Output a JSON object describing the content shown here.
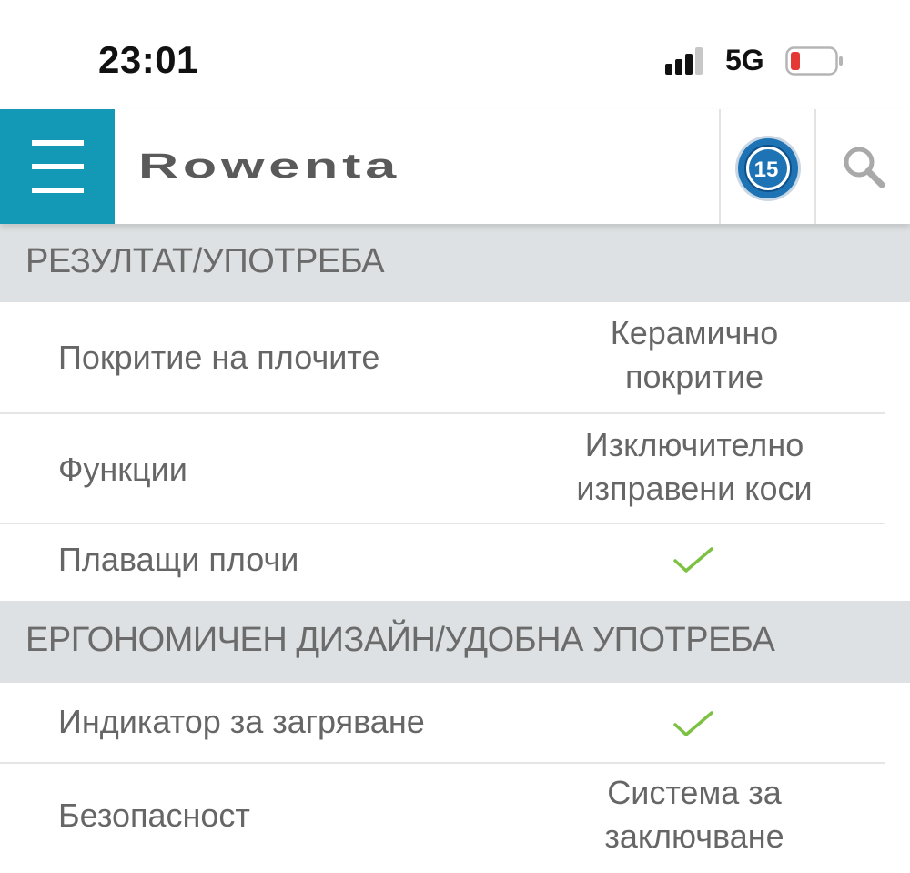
{
  "status_bar": {
    "time": "23:01",
    "network": "5G",
    "icons": [
      "signal-icon",
      "battery-low-icon"
    ]
  },
  "header": {
    "brand": "Rowenta",
    "badge_number": "15",
    "icons": [
      "hamburger-menu-icon",
      "warranty-badge-icon",
      "search-icon"
    ],
    "colors": {
      "menu_background": "#1398b6",
      "badge_blue": "#1e73b4"
    }
  },
  "sections": [
    {
      "title": "РЕЗУЛТАТ/УПОТРЕБА",
      "rows": [
        {
          "label": "Покритие на плочите",
          "value_lines": [
            "Керамично",
            "покритие"
          ]
        },
        {
          "label": "Функции",
          "value_lines": [
            "Изключително",
            "изправени коси"
          ]
        },
        {
          "label": "Плаващи плочи",
          "check": true
        }
      ]
    },
    {
      "title": "ЕРГОНОМИЧЕН ДИЗАЙН/УДОБНА УПОТРЕБА",
      "rows": [
        {
          "label": "Индикатор за загряване",
          "check": true
        },
        {
          "label": "Безопасност",
          "value_lines": [
            "Система за",
            "заключване"
          ]
        }
      ]
    }
  ],
  "colors": {
    "section_background": "#dee1e3",
    "check_green": "#7cc142",
    "battery_red": "#e53935"
  }
}
